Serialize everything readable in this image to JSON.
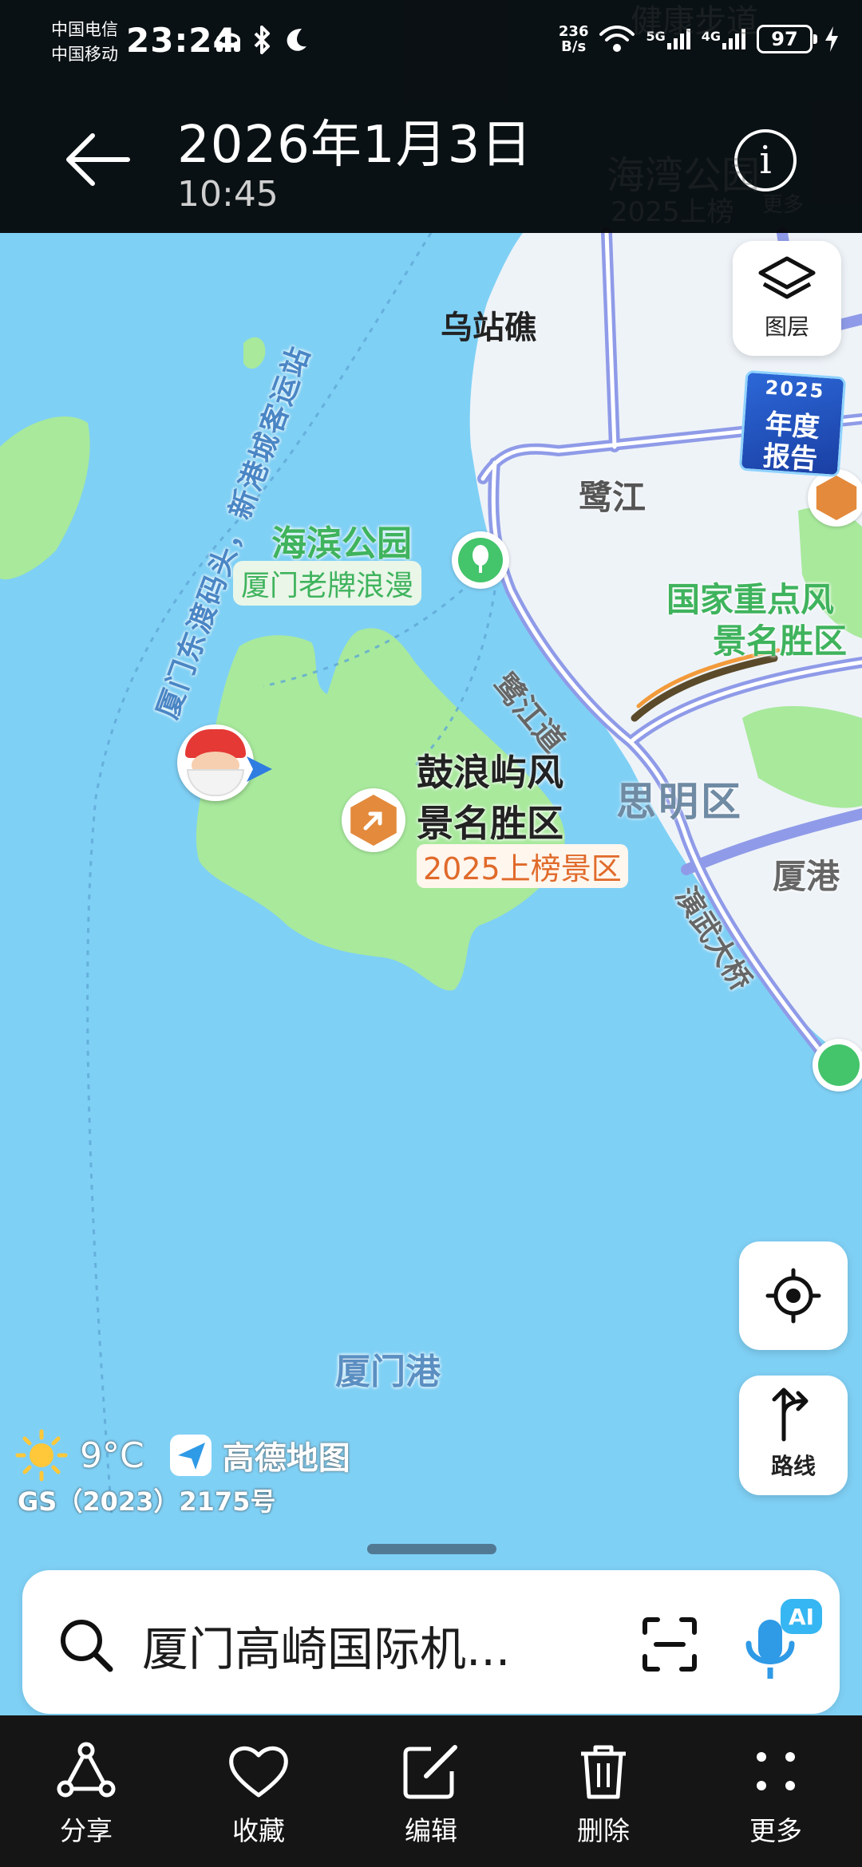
{
  "status_bar": {
    "carrier_1": "中国电信",
    "carrier_2": "中国移动",
    "time": "23:24",
    "net_speed_value": "236",
    "net_speed_unit": "B/s",
    "signal_1": "5G",
    "signal_2": "4G",
    "battery": "97"
  },
  "header": {
    "date": "2026年1月3日",
    "time": "10:45"
  },
  "map": {
    "labels": {
      "wuzhanjiao": "乌站礁",
      "ferry_line": "厦门东渡码头，新港城客运站",
      "lujiang": "鹭江",
      "haibin_park": "海滨公园",
      "haibin_sub": "厦门老牌浪漫",
      "gulangyu_1": "鼓浪屿风",
      "gulangyu_2": "景名胜区",
      "gulangyu_badge": "2025上榜景区",
      "national_1": "国家重点风",
      "national_2": "景名胜区",
      "lujiang_road": "鹭江道",
      "siming": "思明区",
      "xiagang": "厦港",
      "yanwu_bridge": "演武大桥",
      "xiamen_port": "厦门港",
      "bg_label_1": "海湾公园",
      "bg_label_2": "2025上榜",
      "bg_label_3": "更多",
      "bg_label_4": "健康步道"
    },
    "annual_report": {
      "year": "2025",
      "line1": "年度",
      "line2": "报告"
    },
    "layers_label": "图层",
    "route_label": "路线",
    "weather_temp": "9°C",
    "brand": "高德地图",
    "license": "GS（2023）2175号"
  },
  "search": {
    "value": "厦门高崎国际机..."
  },
  "bottom_nav": [
    {
      "label": "分享",
      "icon": "share-icon"
    },
    {
      "label": "收藏",
      "icon": "heart-icon"
    },
    {
      "label": "编辑",
      "icon": "edit-icon"
    },
    {
      "label": "删除",
      "icon": "trash-icon"
    },
    {
      "label": "更多",
      "icon": "more-icon"
    }
  ],
  "colors": {
    "sea": "#7fd0f5",
    "land_island": "#a8e99c",
    "road": "#8f9be8",
    "poi_orange": "#e48a3c",
    "park_green": "#44c46b"
  }
}
